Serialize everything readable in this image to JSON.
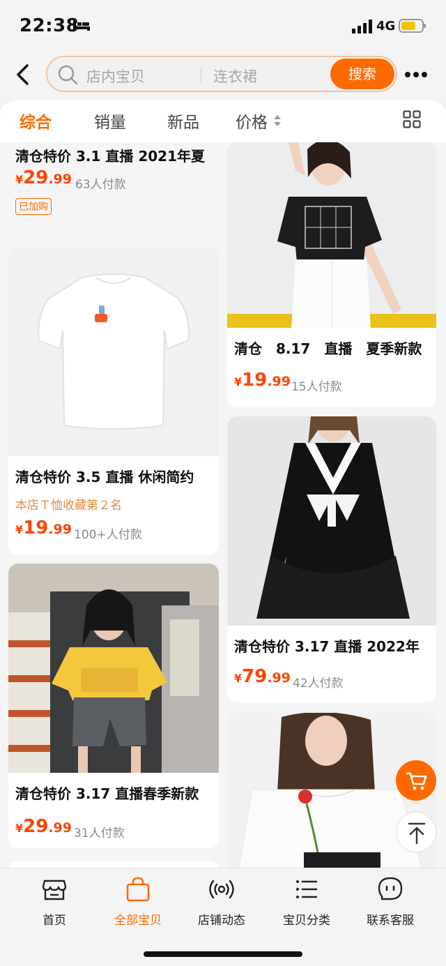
{
  "status_bar": {
    "time": "22:38",
    "network": "4G"
  },
  "search": {
    "placeholder": "店内宝贝",
    "suggestion": "连衣裙",
    "button": "搜索"
  },
  "tabs": [
    {
      "label": "综合",
      "active": true
    },
    {
      "label": "销量",
      "active": false
    },
    {
      "label": "新品",
      "active": false
    },
    {
      "label": "价格",
      "active": false
    }
  ],
  "products": {
    "p1": {
      "title": "清仓特价 3.1 直播 2021年夏",
      "yen": "¥",
      "price_int": "29",
      "price_dec": ".99",
      "sold": "63人付款",
      "badge": "已加购"
    },
    "p2": {
      "title": "清仓　8.17　直播　夏季新款",
      "yen": "¥",
      "price_int": "19",
      "price_dec": ".99",
      "sold": "15人付款"
    },
    "p3": {
      "title": "清仓特价 3.5 直播 休闲简约",
      "tagline": "本店Ｔ恤收藏第２名",
      "yen": "¥",
      "price_int": "19",
      "price_dec": ".99",
      "sold": "100+人付款"
    },
    "p4": {
      "title": "清仓特价 3.17 直播 2022年",
      "yen": "¥",
      "price_int": "79",
      "price_dec": ".99",
      "sold": "42人付款"
    },
    "p5": {
      "title": "清仓特价 3.17 直播春季新款",
      "yen": "¥",
      "price_int": "29",
      "price_dec": ".99",
      "sold": "31人付款"
    },
    "p6": {}
  },
  "nav": [
    {
      "label": "首页",
      "icon": "store-icon",
      "active": false
    },
    {
      "label": "全部宝贝",
      "icon": "shopping-bag-icon",
      "active": true
    },
    {
      "label": "店铺动态",
      "icon": "broadcast-icon",
      "active": false
    },
    {
      "label": "宝贝分类",
      "icon": "list-icon",
      "active": false
    },
    {
      "label": "联系客服",
      "icon": "chat-face-icon",
      "active": false
    }
  ],
  "colors": {
    "accent": "#ff6a00",
    "price": "#ff4400",
    "tagline": "#e3893d"
  }
}
